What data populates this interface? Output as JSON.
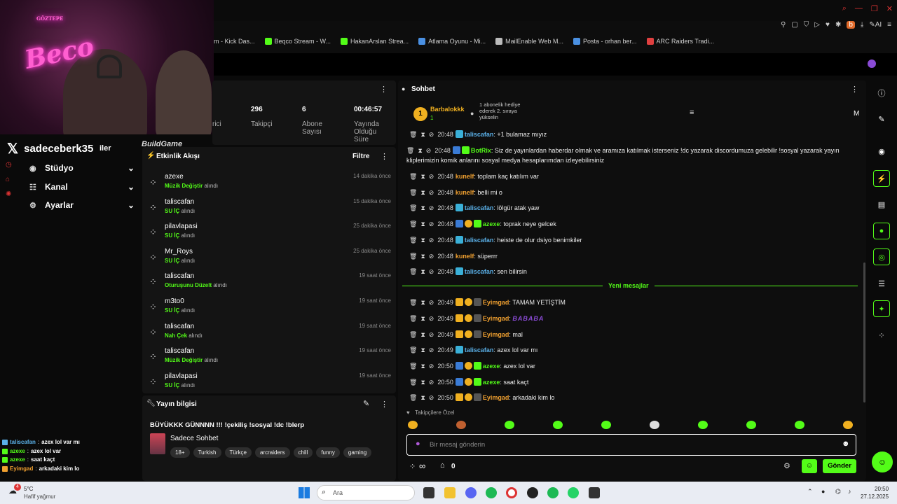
{
  "browser": {
    "bookmarks": [
      {
        "label": "am - Kick Das...",
        "color": "#53fc18"
      },
      {
        "label": "Beqco Stream - W...",
        "color": "#53fc18"
      },
      {
        "label": "HakanArslan Strea...",
        "color": "#53fc18"
      },
      {
        "label": "Atlama Oyunu - Mi...",
        "color": "#4a90e2"
      },
      {
        "label": "MailEnable Web M...",
        "color": "#bbbbbb"
      },
      {
        "label": "Posta - orhan ber...",
        "color": "#4a90e2"
      },
      {
        "label": "ARC Raiders Tradi...",
        "color": "#e04040"
      }
    ],
    "ai_label": "AI"
  },
  "webcam": {
    "neon_text": "Beco",
    "neon_sub": "GÖZTEPE"
  },
  "overlay": {
    "logo_text": "BuildGame"
  },
  "sidebar": {
    "channel": "sadeceberk35",
    "channel_suffix": "iler",
    "menu": [
      {
        "label": "Stüdyo",
        "icon": "studio-icon"
      },
      {
        "label": "Kanal",
        "icon": "channel-icon"
      },
      {
        "label": "Ayarlar",
        "icon": "settings-icon"
      }
    ]
  },
  "stats": {
    "partial_label": "rici",
    "items": [
      {
        "value": "296",
        "label": "Takipçi"
      },
      {
        "value": "6",
        "label": "Abone Sayısı"
      },
      {
        "value": "00:46:57",
        "label": "Yayında Olduğu Süre"
      }
    ]
  },
  "activity": {
    "title": "Etkinlik Akışı",
    "filter": "Filtre",
    "received": "alındı",
    "items": [
      {
        "user": "azexe",
        "reward": "Müzik Değiştir",
        "time": "14 dakika önce"
      },
      {
        "user": "taliscafan",
        "reward": "SU İÇ",
        "time": "15 dakika önce"
      },
      {
        "user": "pilavlapasi",
        "reward": "SU İÇ",
        "time": "25 dakika önce"
      },
      {
        "user": "Mr_Roys",
        "reward": "SU İÇ",
        "time": "25 dakika önce"
      },
      {
        "user": "taliscafan",
        "reward": "Oturuşunu Düzelt",
        "time": "19 saat önce"
      },
      {
        "user": "m3to0",
        "reward": "SU İÇ",
        "time": "19 saat önce"
      },
      {
        "user": "taliscafan",
        "reward": "Nah Çek",
        "time": "19 saat önce"
      },
      {
        "user": "taliscafan",
        "reward": "Müzik Değiştir",
        "time": "19 saat önce"
      },
      {
        "user": "pilavlapasi",
        "reward": "SU İÇ",
        "time": "19 saat önce"
      }
    ]
  },
  "stream_info": {
    "title": "Yayın bilgisi",
    "stream_title": "BÜYÜKKK GÜNNNN !!! !çekiliş !sosyal !dc !blerp",
    "category": "Sadece Sohbet",
    "tags": [
      "18+",
      "Turkish",
      "Türkçe",
      "arcraiders",
      "chill",
      "funny",
      "gaming"
    ]
  },
  "chat": {
    "title": "Sohbet",
    "pinned": {
      "rank": "1",
      "user": "Barbalokkk",
      "count": "1",
      "text": "1 abonelik hediye ederek 2. sıraya yükselin"
    },
    "pinned_right": "M",
    "new_messages_divider": "Yeni mesajlar",
    "messages": [
      {
        "time": "20:48",
        "user": "taliscafan",
        "user_color": "#5ab0e8",
        "badges": [
          "#3ab0d8"
        ],
        "text": "+1 bulamaz mıyız"
      },
      {
        "time": "20:48",
        "user": "BotRix",
        "user_color": "#53fc18",
        "badges": [
          "#3a7bd5",
          "#53fc18"
        ],
        "text": "Siz de yayınlardan haberdar olmak ve aramıza katılmak isterseniz !dc yazarak discordumuza gelebilir !sosyal yazarak yayın kliplerimizin komik anlarını sosyal medya hesaplarımdan izleyebilirsiniz"
      },
      {
        "time": "20:48",
        "user": "kunelf",
        "user_color": "#f0a030",
        "badges": [],
        "text": "toplam kaç katılım var"
      },
      {
        "time": "20:48",
        "user": "kunelf",
        "user_color": "#f0a030",
        "badges": [],
        "text": "belli mi o"
      },
      {
        "time": "20:48",
        "user": "taliscafan",
        "user_color": "#5ab0e8",
        "badges": [
          "#3ab0d8"
        ],
        "text": "lölgür atak yaw"
      },
      {
        "time": "20:48",
        "user": "azexe",
        "user_color": "#53fc18",
        "badges": [
          "#3a7bd5",
          "#f0b020",
          "#53fc18"
        ],
        "text": "toprak neye gelcek"
      },
      {
        "time": "20:48",
        "user": "taliscafan",
        "user_color": "#5ab0e8",
        "badges": [
          "#3ab0d8"
        ],
        "text": "heiste de olur dsiyo benimkiler"
      },
      {
        "time": "20:48",
        "user": "kunelf",
        "user_color": "#f0a030",
        "badges": [],
        "text": "süperrr"
      },
      {
        "time": "20:48",
        "user": "taliscafan",
        "user_color": "#5ab0e8",
        "badges": [
          "#3ab0d8"
        ],
        "text": "sen bilirsin"
      },
      {
        "time": "20:49",
        "user": "Eyimgad",
        "user_color": "#f0a030",
        "badges": [
          "#f0b020",
          "#f0b020",
          "#555555"
        ],
        "text": "TAMAM YETİŞTİM"
      },
      {
        "time": "20:49",
        "user": "Eyimgad",
        "user_color": "#f0a030",
        "badges": [
          "#f0b020",
          "#f0b020",
          "#555555"
        ],
        "text": "BABABA"
      },
      {
        "time": "20:49",
        "user": "Eyimgad",
        "user_color": "#f0a030",
        "badges": [
          "#f0b020",
          "#f0b020",
          "#555555"
        ],
        "text": "mal"
      },
      {
        "time": "20:49",
        "user": "taliscafan",
        "user_color": "#5ab0e8",
        "badges": [
          "#3ab0d8"
        ],
        "text": "azex lol var mı"
      },
      {
        "time": "20:50",
        "user": "azexe",
        "user_color": "#53fc18",
        "badges": [
          "#3a7bd5",
          "#f0b020",
          "#53fc18"
        ],
        "text": "azex lol var"
      },
      {
        "time": "20:50",
        "user": "azexe",
        "user_color": "#53fc18",
        "badges": [
          "#3a7bd5",
          "#f0b020",
          "#53fc18"
        ],
        "text": "saat kaçt"
      },
      {
        "time": "20:50",
        "user": "Eyimgad",
        "user_color": "#f0a030",
        "badges": [
          "#f0b020",
          "#f0b020",
          "#555555"
        ],
        "text": "arkadaki kim lo"
      }
    ],
    "followers_only": "Takipçilere Özel",
    "input_placeholder": "Bir mesaj gönderin",
    "points": "∞",
    "count": "0",
    "send_label": "Gönder"
  },
  "mini_chat": [
    {
      "user": "taliscafan",
      "text": "azex lol var mı",
      "color": "#5ab0e8"
    },
    {
      "user": "azexe",
      "text": "azex lol var",
      "color": "#53fc18"
    },
    {
      "user": "azexe",
      "text": "saat kaçt",
      "color": "#53fc18"
    },
    {
      "user": "Eyimgad",
      "text": "arkadaki kim lo",
      "color": "#f0a030"
    }
  ],
  "taskbar": {
    "weather_temp": "5°C",
    "weather_desc": "Hafif yağmur",
    "weather_badge": "4",
    "search": "Ara",
    "time": "20:50",
    "date": "27.12.2025"
  },
  "colors": {
    "accent": "#53fc18",
    "bg": "#0e0e0e",
    "panel": "#141414"
  }
}
